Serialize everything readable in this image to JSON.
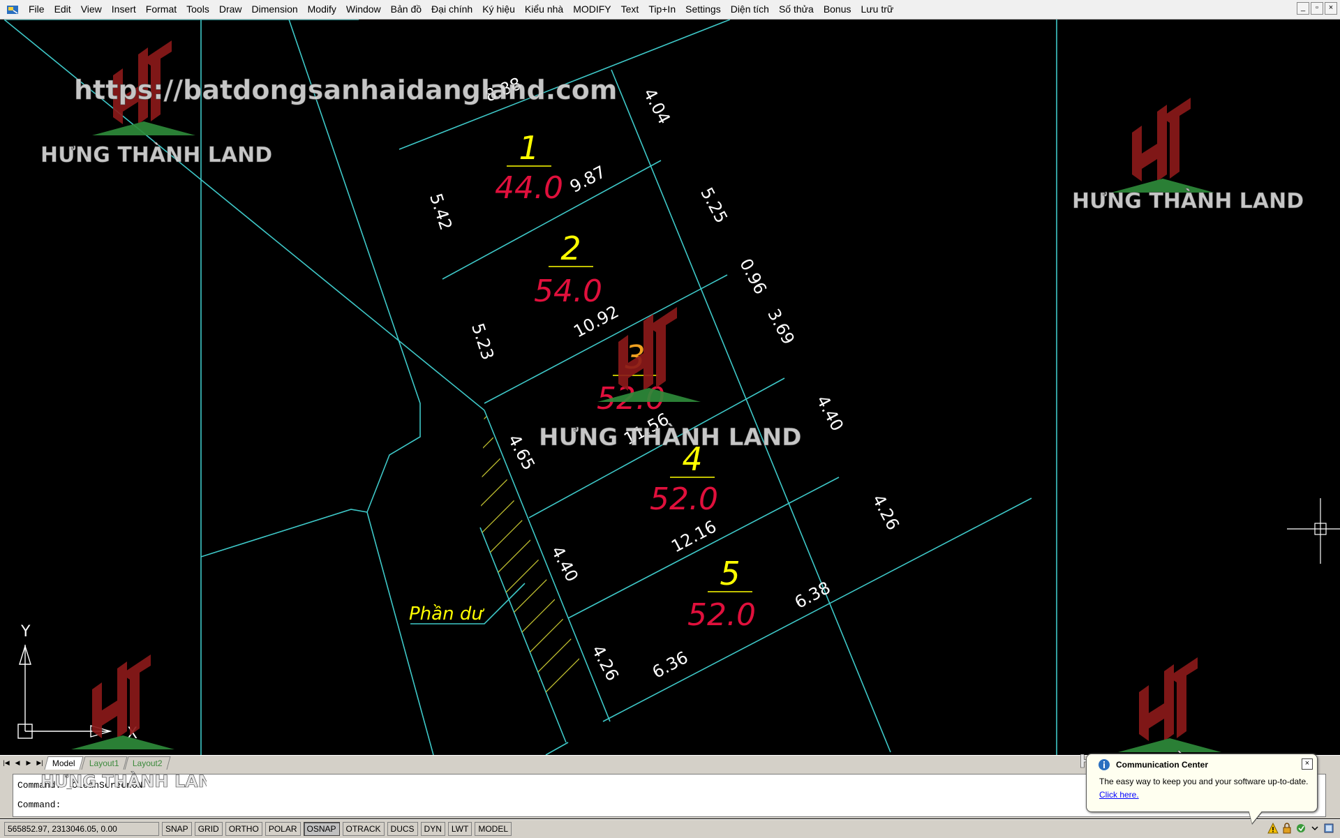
{
  "menu": [
    "File",
    "Edit",
    "View",
    "Insert",
    "Format",
    "Tools",
    "Draw",
    "Dimension",
    "Modify",
    "Window",
    "Bản đồ",
    "Đại chính",
    "Ký hiệu",
    "Kiểu nhà",
    "MODIFY",
    "Text",
    "Tip+In",
    "Settings",
    "Diện tích",
    "Số thửa",
    "Bonus",
    "Lưu trữ"
  ],
  "window_controls": {
    "minimize": "_",
    "restore": "▫",
    "close": "×"
  },
  "watermark": {
    "url": "https://batdongsanhaidangland.com",
    "brand": "HƯNG THÀNH LAND",
    "logo_letters": "HT"
  },
  "lots": [
    {
      "number": "1",
      "area": "44.0"
    },
    {
      "number": "2",
      "area": "54.0"
    },
    {
      "number": "3",
      "area": "52.0"
    },
    {
      "number": "4",
      "area": "52.0"
    },
    {
      "number": "5",
      "area": "52.0"
    }
  ],
  "dimensions": [
    "8.88",
    "4.04",
    "9.87",
    "5.42",
    "5.25",
    "0.96",
    "3.69",
    "10.92",
    "5.23",
    "11.56",
    "4.40",
    "4.65",
    "4.26",
    "12.16",
    "4.40",
    "6.38",
    "6.36",
    "4.26"
  ],
  "remainder_label": "Phần dư",
  "ucs": {
    "y": "Y",
    "x": "X"
  },
  "tabs": {
    "model": "Model",
    "layout1": "Layout1",
    "layout2": "Layout2"
  },
  "commands": [
    "Command: _CleanScreenON",
    "Command:"
  ],
  "status": {
    "coords": "565852.97, 2313046.05, 0.00",
    "buttons": [
      "SNAP",
      "GRID",
      "ORTHO",
      "POLAR",
      "OSNAP",
      "OTRACK",
      "DUCS",
      "DYN",
      "LWT",
      "MODEL"
    ]
  },
  "balloon": {
    "title": "Communication Center",
    "text": "The easy way to keep you and your software up-to-date.",
    "link": "Click here."
  },
  "colors": {
    "cad_line": "#3ec8c8",
    "lot_number": "#ffff00",
    "area": "#e0103c",
    "dim_text": "#ffffff",
    "hatch": "#c8c832",
    "watermark": "#8b1a1a",
    "watermark_green": "#2e8b3a"
  }
}
